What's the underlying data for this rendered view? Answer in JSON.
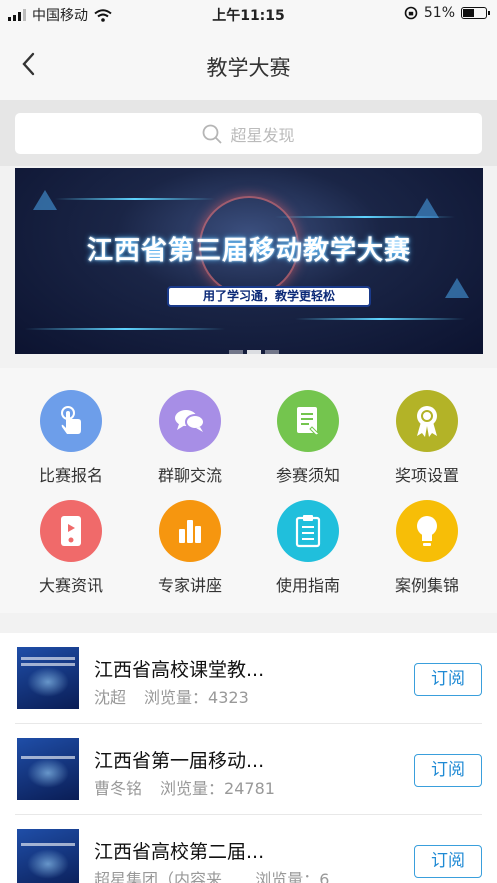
{
  "status_bar": {
    "carrier": "中国移动",
    "time": "上午11:15",
    "battery": "51%",
    "battery_level": 0.51
  },
  "nav": {
    "title": "教学大赛"
  },
  "search": {
    "placeholder": "超星发现"
  },
  "banner": {
    "title": "江西省第三届移动教学大赛",
    "subtitle": "用了学习通，教学更轻松",
    "slides": 3,
    "active_slide": 1
  },
  "grid": [
    {
      "label": "比赛报名",
      "icon": "tap-hand-icon",
      "color": "#6d9eea"
    },
    {
      "label": "群聊交流",
      "icon": "chat-bubbles-icon",
      "color": "#a78ee6"
    },
    {
      "label": "参赛须知",
      "icon": "document-icon",
      "color": "#74c54e"
    },
    {
      "label": "奖项设置",
      "icon": "award-ribbon-icon",
      "color": "#b3b327"
    },
    {
      "label": "大赛资讯",
      "icon": "phone-play-icon",
      "color": "#f06a6a"
    },
    {
      "label": "专家讲座",
      "icon": "bar-chart-icon",
      "color": "#f6960f"
    },
    {
      "label": "使用指南",
      "icon": "clipboard-checklist-icon",
      "color": "#20bfdc"
    },
    {
      "label": "案例集锦",
      "icon": "lightbulb-icon",
      "color": "#f7be07"
    }
  ],
  "list": [
    {
      "title": "江西省高校课堂教...",
      "author": "沈超",
      "views_label": "浏览量：",
      "views": "4323",
      "action": "订阅"
    },
    {
      "title": "江西省第一届移动...",
      "author": "曹冬铭",
      "views_label": "浏览量：",
      "views": "24781",
      "action": "订阅"
    },
    {
      "title": "江西省高校第二届...",
      "author": "超星集团（内容来...",
      "views_label": "浏览量：",
      "views": "6...",
      "action": "订阅"
    }
  ],
  "colors": {
    "accent": "#1f8ad4",
    "background": "#f2f2f2"
  }
}
